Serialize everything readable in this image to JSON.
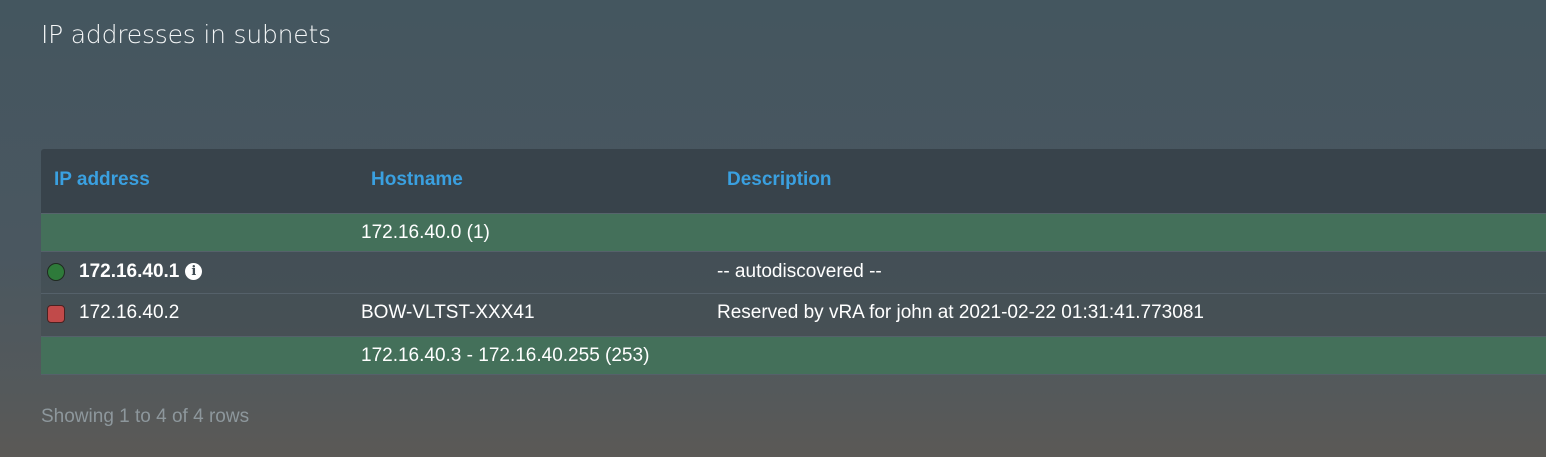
{
  "page": {
    "title": "IP addresses in subnets"
  },
  "table": {
    "columns": {
      "ip": "IP address",
      "hostname": "Hostname",
      "description": "Description"
    },
    "rows": [
      {
        "type": "free",
        "range": "172.16.40.0 (1)"
      },
      {
        "type": "address",
        "status": "online",
        "status_color": "#2e7a3a",
        "ip": "172.16.40.1",
        "info_icon": "info-circle-icon",
        "hostname": "",
        "description": "-- autodiscovered --"
      },
      {
        "type": "address",
        "status": "reserved",
        "status_color": "#c14a4a",
        "ip": "172.16.40.2",
        "hostname": "BOW-VLTST-XXX41",
        "description": "Reserved by vRA for john at 2021-02-22 01:31:41.773081"
      },
      {
        "type": "free",
        "range": "172.16.40.3 - 172.16.40.255 (253)"
      }
    ]
  },
  "footer": {
    "pagination_text": "Showing 1 to 4 of 4 rows"
  },
  "colors": {
    "header_link": "#3aa0e0",
    "free_row": "#44705a",
    "header_bg": "#38434b"
  },
  "icons": {
    "info": "info-circle-icon",
    "online": "green-circle-status-icon",
    "reserved": "red-square-status-icon"
  }
}
